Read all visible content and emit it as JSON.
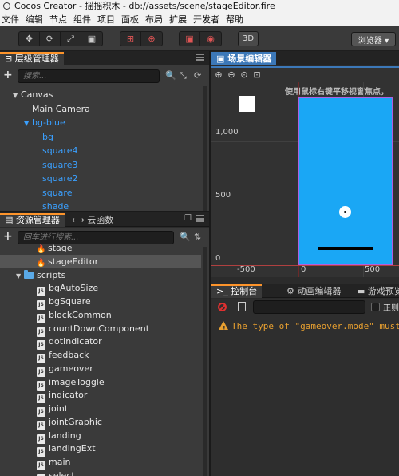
{
  "window": {
    "title": "Cocos Creator - 摇摇积木 - db://assets/scene/stageEditor.fire"
  },
  "menu": [
    "文件",
    "编辑",
    "节点",
    "组件",
    "项目",
    "面板",
    "布局",
    "扩展",
    "开发者",
    "帮助"
  ],
  "toolbar": {
    "transform_tools": [
      "move-tool",
      "rotate-tool",
      "scale-tool",
      "rect-tool"
    ],
    "three_d_label": "3D",
    "browser_label": "浏览器 ▾"
  },
  "hierarchy": {
    "tab_label": "层级管理器",
    "search_placeholder": "搜索...",
    "nodes": [
      {
        "label": "Canvas",
        "depth": 1,
        "color": "white",
        "expanded": true
      },
      {
        "label": "Main Camera",
        "depth": 2,
        "color": "white"
      },
      {
        "label": "bg-blue",
        "depth": 2,
        "color": "blue",
        "expanded": true
      },
      {
        "label": "bg",
        "depth": 3,
        "color": "blue"
      },
      {
        "label": "square4",
        "depth": 3,
        "color": "blue"
      },
      {
        "label": "square3",
        "depth": 3,
        "color": "blue"
      },
      {
        "label": "square2",
        "depth": 3,
        "color": "blue"
      },
      {
        "label": "square",
        "depth": 3,
        "color": "blue"
      },
      {
        "label": "shade",
        "depth": 3,
        "color": "blue"
      }
    ]
  },
  "assets": {
    "tab_label": "资源管理器",
    "tab2_label": "云函数",
    "search_placeholder": "回车进行搜索...",
    "items": [
      {
        "label": "stage",
        "type": "fire"
      },
      {
        "label": "stageEditor",
        "type": "fire",
        "selected": true
      },
      {
        "label": "scripts",
        "type": "folder"
      },
      {
        "label": "bgAutoSize",
        "type": "js"
      },
      {
        "label": "bgSquare",
        "type": "js"
      },
      {
        "label": "blockCommon",
        "type": "js"
      },
      {
        "label": "countDownComponent",
        "type": "js"
      },
      {
        "label": "dotIndicator",
        "type": "js"
      },
      {
        "label": "feedback",
        "type": "js"
      },
      {
        "label": "gameover",
        "type": "js"
      },
      {
        "label": "imageToggle",
        "type": "js"
      },
      {
        "label": "indicator",
        "type": "js"
      },
      {
        "label": "joint",
        "type": "js"
      },
      {
        "label": "jointGraphic",
        "type": "js"
      },
      {
        "label": "landing",
        "type": "js"
      },
      {
        "label": "landingExt",
        "type": "js"
      },
      {
        "label": "main",
        "type": "js"
      },
      {
        "label": "select",
        "type": "js"
      }
    ]
  },
  "scene": {
    "tab_label": "场景编辑器",
    "hint": "使用鼠标右键平移视窗焦点，",
    "y_labels": [
      "1,000",
      "500",
      "0"
    ],
    "x_labels": [
      "-500",
      "0",
      "500"
    ],
    "canvas_color": "#1aa7f5"
  },
  "console": {
    "tabs": [
      "控制台",
      "动画编辑器",
      "游戏预览"
    ],
    "regex_label": "正则",
    "messages": [
      {
        "level": "warn",
        "text": "The type of \"gameover.mode\" must"
      }
    ]
  }
}
